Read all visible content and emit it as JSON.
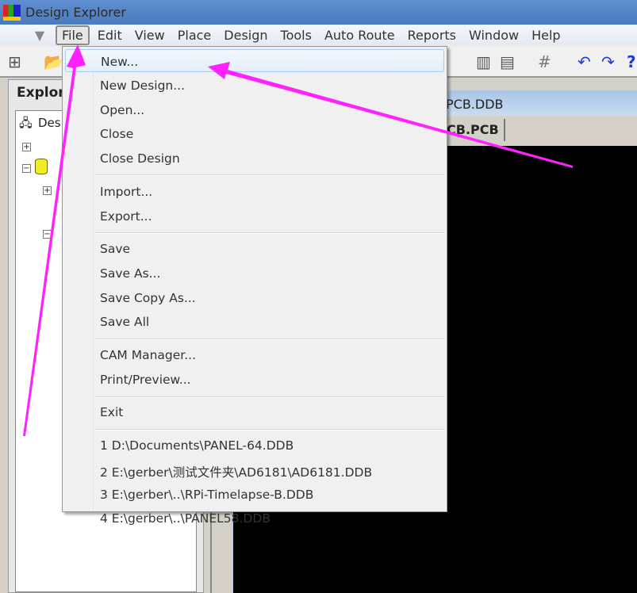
{
  "window": {
    "title": "Design Explorer"
  },
  "menubar": [
    "File",
    "Edit",
    "View",
    "Place",
    "Design",
    "Tools",
    "Auto Route",
    "Reports",
    "Window",
    "Help"
  ],
  "explorer": {
    "tab": "Explorer",
    "root": "Des"
  },
  "document": {
    "title": "PCB.DDB",
    "tab": "CB.PCB"
  },
  "file_menu": {
    "groups": [
      [
        "New...",
        "New Design...",
        "Open...",
        "Close",
        "Close Design"
      ],
      [
        "Import...",
        "Export..."
      ],
      [
        "Save",
        "Save As...",
        "Save Copy As...",
        "Save All"
      ],
      [
        "CAM Manager...",
        "Print/Preview..."
      ],
      [
        "Exit"
      ],
      [
        "1 D:\\Documents\\PANEL-64.DDB",
        "2 E:\\gerber\\测试文件夹\\AD6181\\AD6181.DDB",
        "3 E:\\gerber\\..\\RPi-Timelapse-B.DDB",
        "4 E:\\gerber\\..\\PANEL58.DDB"
      ]
    ],
    "highlighted": "New..."
  },
  "annotation_color": "#ff22ff"
}
